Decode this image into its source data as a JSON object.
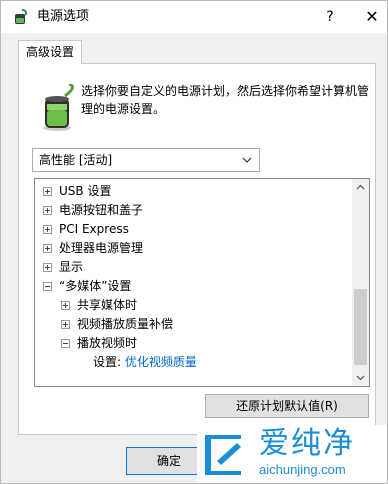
{
  "window": {
    "title": "电源选项",
    "help": "?",
    "close": "✕"
  },
  "tab": {
    "label": "高级设置"
  },
  "description": "选择你要自定义的电源计划，然后选择你希望计算机管理的电源设置。",
  "plan_select": {
    "value": "高性能 [活动]"
  },
  "tree": {
    "rows": [
      {
        "label": "USB 设置",
        "expander": "plus"
      },
      {
        "label": "电源按钮和盖子",
        "expander": "plus"
      },
      {
        "label": "PCI Express",
        "expander": "plus"
      },
      {
        "label": "处理器电源管理",
        "expander": "plus"
      },
      {
        "label": "显示",
        "expander": "plus"
      },
      {
        "label": "“多媒体”设置",
        "expander": "minus"
      },
      {
        "label": "共享媒体时",
        "expander": "plus"
      },
      {
        "label": "视频播放质量补偿",
        "expander": "plus"
      },
      {
        "label": "播放视频时",
        "expander": "minus"
      }
    ],
    "setting": {
      "label": "设置:",
      "value": "优化视频质量"
    }
  },
  "buttons": {
    "restore": "还原计划默认值(R)",
    "ok": "确定"
  },
  "watermark": {
    "text_cn": "爱纯净",
    "url": "aichunjing.com"
  },
  "colors": {
    "link_blue": "#0066cc",
    "watermark_blue": "#1a8ed8"
  }
}
